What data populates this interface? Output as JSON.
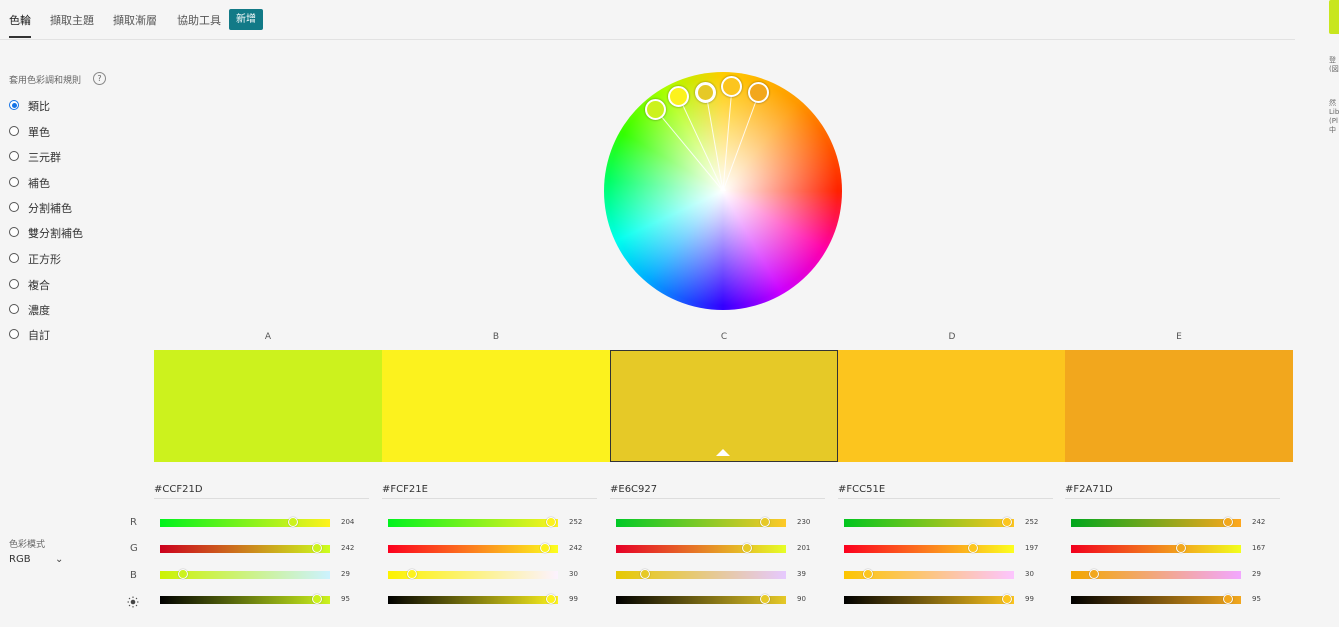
{
  "tabs": [
    {
      "label": "色輪"
    },
    {
      "label": "擷取主題"
    },
    {
      "label": "擷取漸層"
    },
    {
      "label": "協助工具"
    }
  ],
  "new_label": "新增",
  "rules_title": "套用色彩調和規則",
  "help_glyph": "?",
  "rules": [
    {
      "label": "類比",
      "selected": true
    },
    {
      "label": "單色",
      "selected": false
    },
    {
      "label": "三元群",
      "selected": false
    },
    {
      "label": "補色",
      "selected": false
    },
    {
      "label": "分割補色",
      "selected": false
    },
    {
      "label": "雙分割補色",
      "selected": false
    },
    {
      "label": "正方形",
      "selected": false
    },
    {
      "label": "複合",
      "selected": false
    },
    {
      "label": "濃度",
      "selected": false
    },
    {
      "label": "自訂",
      "selected": false
    }
  ],
  "color_mode": {
    "label": "色彩模式",
    "value": "RGB",
    "chevron": "⌄"
  },
  "row_labels": [
    "R",
    "G",
    "B"
  ],
  "columns": [
    {
      "letter": "A",
      "hex": "#CCF21D",
      "r": 204,
      "g": 242,
      "b": 29,
      "brightness": 95
    },
    {
      "letter": "B",
      "hex": "#FCF21E",
      "r": 252,
      "g": 242,
      "b": 30,
      "brightness": 99
    },
    {
      "letter": "C",
      "hex": "#E6C927",
      "r": 230,
      "g": 201,
      "b": 39,
      "brightness": 90
    },
    {
      "letter": "D",
      "hex": "#FCC51E",
      "r": 252,
      "g": 197,
      "b": 30,
      "brightness": 99
    },
    {
      "letter": "E",
      "hex": "#F2A71D",
      "r": 242,
      "g": 167,
      "b": 29,
      "brightness": 95
    }
  ],
  "selected_column": "C",
  "side_texts": [
    "登\n(図",
    "然\nLib\n(Pl\n中"
  ]
}
